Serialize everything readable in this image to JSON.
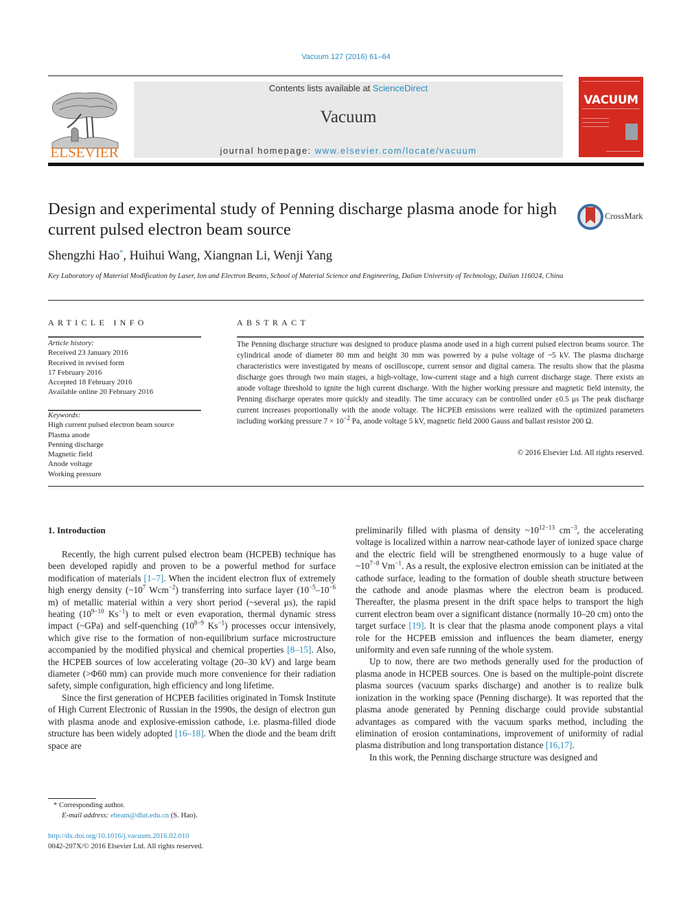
{
  "header": {
    "citation": "Vacuum 127 (2016) 61–64",
    "publisher_logo_text": "ELSEVIER",
    "contents_prefix": "Contents lists available at ",
    "contents_link": "ScienceDirect",
    "journal_name": "Vacuum",
    "homepage_prefix": "journal homepage: ",
    "homepage_link": "www.elsevier.com/locate/vacuum",
    "cover_title": "VACUUM",
    "colors": {
      "link": "#2a8bbf",
      "elsevier_orange": "#e87722",
      "cover_red": "#d42a20",
      "header_box": "#e9e9e9"
    }
  },
  "article": {
    "title": "Design and experimental study of Penning discharge plasma anode for high current pulsed electron beam source",
    "crossmark_label": "CrossMark",
    "authors": {
      "first": "Shengzhi Hao",
      "first_mark": "*",
      "rest": ", Huihui Wang, Xiangnan Li, Wenji Yang"
    },
    "affiliation": "Key Laboratory of Material Modification by Laser, Ion and Electron Beams, School of Material Science and Engineering, Dalian University of Technology, Dalian 116024, China"
  },
  "article_info": {
    "heading": "ARTICLE INFO",
    "history_label": "Article history:",
    "history": [
      "Received 23 January 2016",
      "Received in revised form",
      "17 February 2016",
      "Accepted 18 February 2016",
      "Available online 20 February 2016"
    ],
    "keywords_label": "Keywords:",
    "keywords": [
      "High current pulsed electron beam source",
      "Plasma anode",
      "Penning discharge",
      "Magnetic field",
      "Anode voltage",
      "Working pressure"
    ]
  },
  "abstract": {
    "heading": "ABSTRACT",
    "text_1": "The Penning discharge structure was designed to produce plasma anode used in a high current pulsed electron beams source. The cylindrical anode of diameter 80 mm and height 30 mm was powered by a pulse voltage of ~5 kV. The plasma discharge characteristics were investigated by means of oscilloscope, current sensor and digital camera. The results show that the plasma discharge goes through two main stages, a high-voltage, low-current stage and a high current discharge stage. There exists an anode voltage threshold to ignite the high current discharge. With the higher working pressure and magnetic field intensity, the Penning discharge operates more quickly and steadily. The time accuracy can be controlled under ±0.5 μs The peak discharge current increases proportionally with the anode voltage. The HCPEB emissions were realized with the optimized parameters including working pressure 7 × 10",
    "exp_1": "−2",
    "text_2": " Pa, anode voltage 5 kV, magnetic field 2000 Gauss and ballast resistor 200 Ω.",
    "copyright": "© 2016 Elsevier Ltd. All rights reserved."
  },
  "body": {
    "section_heading": "1.  Introduction",
    "p1": {
      "a": "Recently, the high current pulsed electron beam (HCPEB) technique has been developed rapidly and proven to be a powerful method for surface modification of materials ",
      "ref1": "[1–7]",
      "b": ". When the incident electron flux of extremely high energy density (~10",
      "s1": "7",
      "c": " Wcm",
      "s2": "−2",
      "d": ") transferring into surface layer (10",
      "s3": "−5",
      "e": "–10",
      "s4": "−6",
      "f": " m) of metallic material within a very short period (~several μs), the rapid heating (10",
      "s5": "9−10",
      "g": " Ks",
      "s6": "−1",
      "h": ") to melt or even evaporation, thermal dynamic stress impact (~GPa) and self-quenching (10",
      "s7": "8−9",
      "i": " Ks",
      "s8": "−1",
      "j": ") processes occur intensively, which give rise to the formation of non-equilibrium surface microstructure accompanied by the modified physical and chemical properties ",
      "ref2": "[8–15]",
      "k": ". Also, the HCPEB sources of low accelerating voltage (20–30 kV) and large beam diameter (>Φ60 mm) can provide much more convenience for their radiation safety, simple configuration, high efficiency and long lifetime."
    },
    "p2": {
      "a": "Since the first generation of HCPEB facilities originated in Tomsk Institute of High Current Electronic of Russian in the 1990s, the design of electron gun with plasma anode and explosive-emission cathode, i.e. plasma-filled diode structure has been widely adopted ",
      "ref": "[16–18]",
      "b": ". When the diode and the beam drift space are"
    },
    "p3": {
      "a": "preliminarily filled with plasma of density ~10",
      "s1": "12−13",
      "b": " cm",
      "s2": "−3",
      "c": ", the accelerating voltage is localized within a narrow near-cathode layer of ionized space charge and the electric field will be strengthened enormously to a huge value of ~10",
      "s3": "7−8",
      "d": " Vm",
      "s4": "−1",
      "e": ". As a result, the explosive electron emission can be initiated at the cathode surface, leading to the formation of double sheath structure between the cathode and anode plasmas where the electron beam is produced. Thereafter, the plasma present in the drift space helps to transport the high current electron beam over a significant distance (normally 10–20 cm) onto the target surface ",
      "ref": "[19]",
      "f": ". It is clear that the plasma anode component plays a vital role for the HCPEB emission and influences the beam diameter, energy uniformity and even safe running of the whole system."
    },
    "p4": {
      "a": "Up to now, there are two methods generally used for the production of plasma anode in HCPEB sources. One is based on the multiple-point discrete plasma sources (vacuum sparks discharge) and another is to realize bulk ionization in the working space (Penning discharge). It was reported that the plasma anode generated by Penning discharge could provide substantial advantages as compared with the vacuum sparks method, including the elimination of erosion contaminations, improvement of uniformity of radial plasma distribution and long transportation distance ",
      "ref": "[16,17]",
      "b": "."
    },
    "p5": "In this work, the Penning discharge structure was designed and"
  },
  "footnotes": {
    "corresponding": "* Corresponding author.",
    "email_label": "E-mail address: ",
    "email": "ebeam@dlut.edu.cn",
    "email_suffix": " (S. Hao).",
    "doi_link": "http://dx.doi.org/10.1016/j.vacuum.2016.02.010",
    "issn_copyright": "0042-207X/© 2016 Elsevier Ltd. All rights reserved."
  }
}
